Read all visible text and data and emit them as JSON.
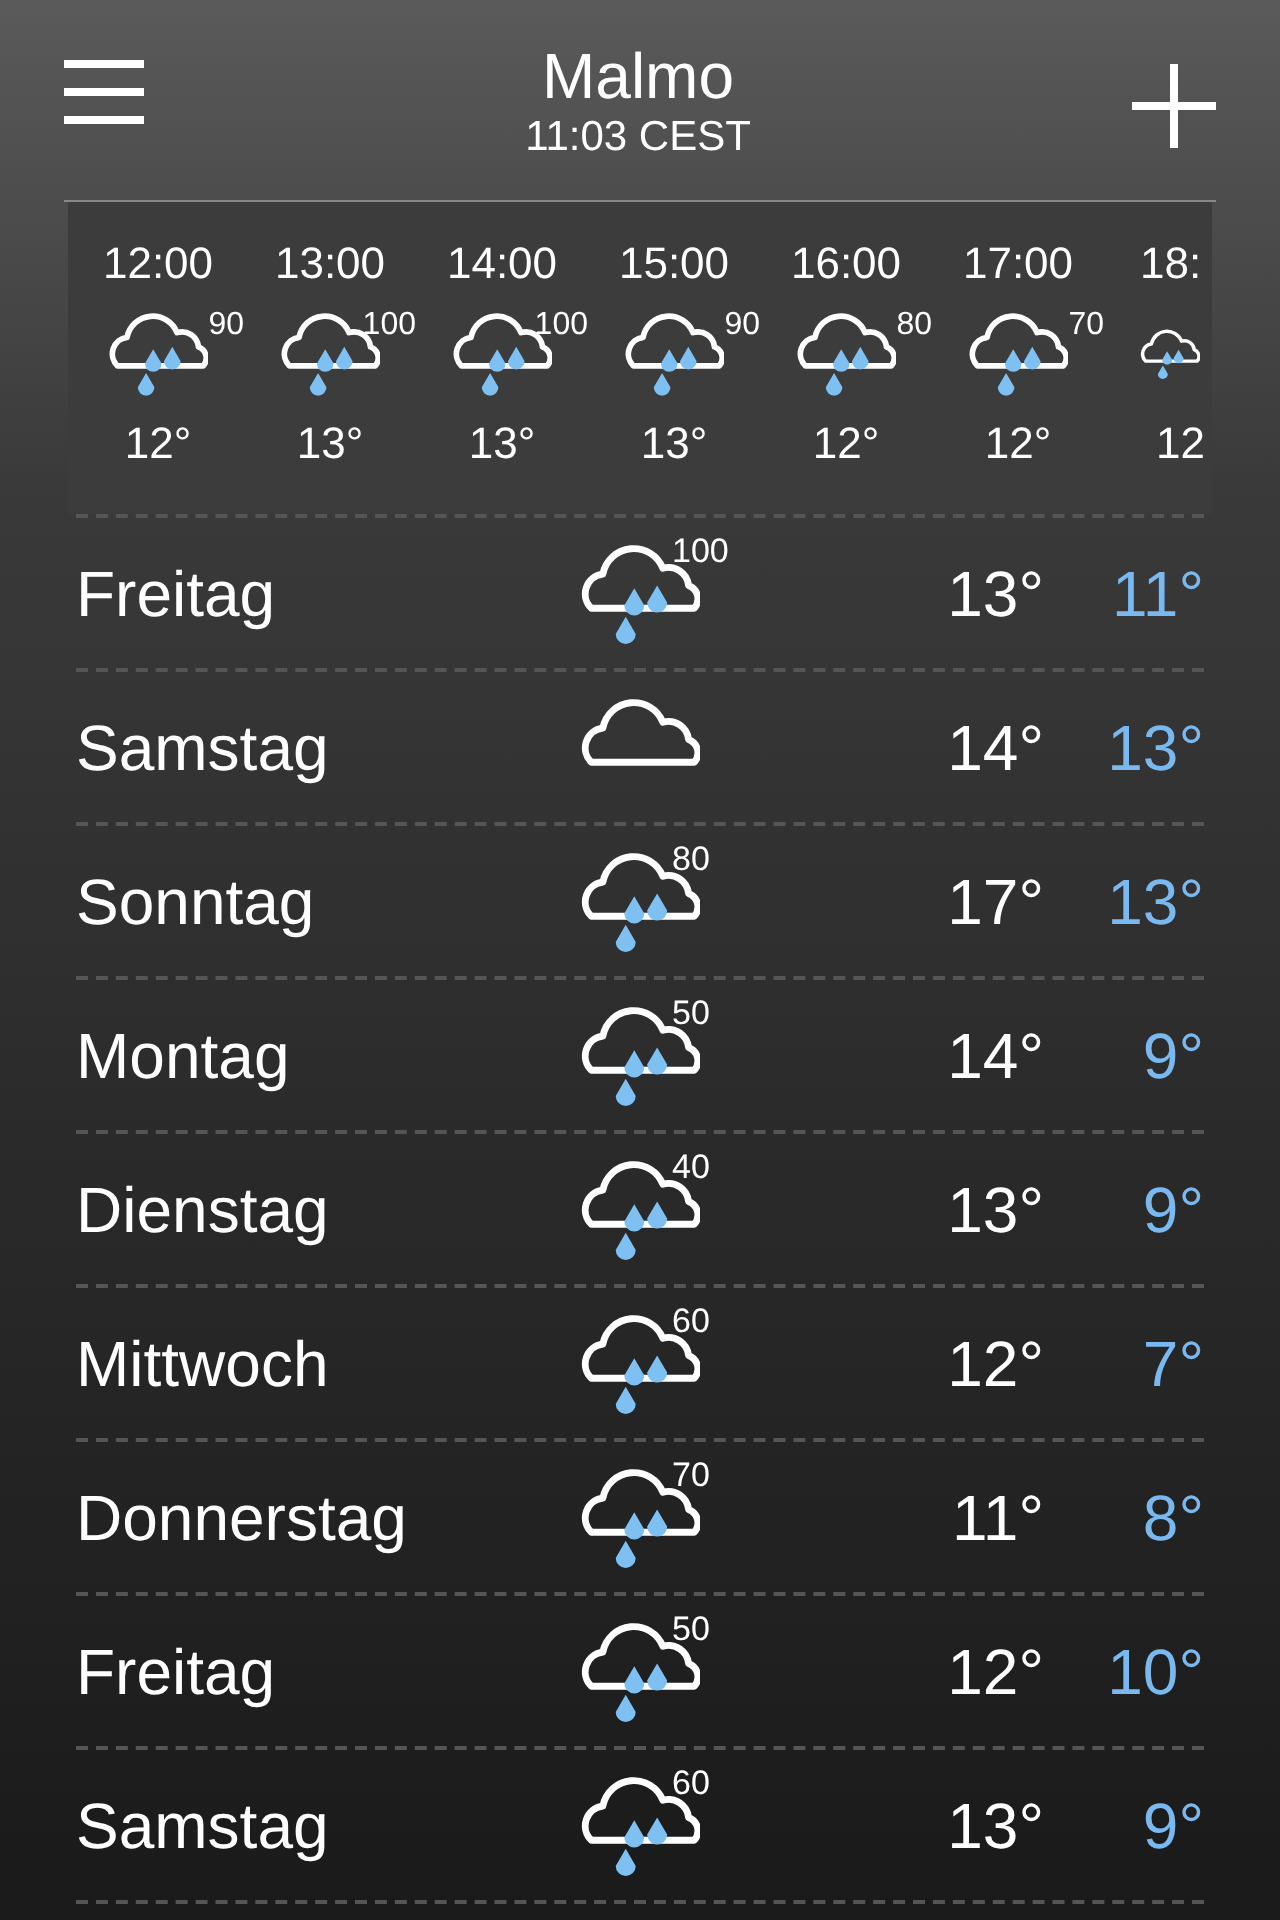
{
  "header": {
    "city": "Malmo",
    "time": "11:03 CEST"
  },
  "hourly": [
    {
      "time": "12:00",
      "kind": "rain",
      "chance": "90",
      "temp": "12°"
    },
    {
      "time": "13:00",
      "kind": "rain",
      "chance": "100",
      "temp": "13°"
    },
    {
      "time": "14:00",
      "kind": "rain",
      "chance": "100",
      "temp": "13°"
    },
    {
      "time": "15:00",
      "kind": "rain",
      "chance": "90",
      "temp": "13°"
    },
    {
      "time": "16:00",
      "kind": "rain",
      "chance": "80",
      "temp": "12°"
    },
    {
      "time": "17:00",
      "kind": "rain",
      "chance": "70",
      "temp": "12°"
    },
    {
      "time": "18:",
      "kind": "rain",
      "temp": "12"
    }
  ],
  "daily": [
    {
      "day": "Freitag",
      "kind": "rain",
      "chance": "100",
      "high": "13°",
      "low": "11°"
    },
    {
      "day": "Samstag",
      "kind": "cloud",
      "high": "14°",
      "low": "13°"
    },
    {
      "day": "Sonntag",
      "kind": "rain",
      "chance": "80",
      "high": "17°",
      "low": "13°"
    },
    {
      "day": "Montag",
      "kind": "rain",
      "chance": "50",
      "high": "14°",
      "low": "9°"
    },
    {
      "day": "Dienstag",
      "kind": "rain",
      "chance": "40",
      "high": "13°",
      "low": "9°"
    },
    {
      "day": "Mittwoch",
      "kind": "rain",
      "chance": "60",
      "high": "12°",
      "low": "7°"
    },
    {
      "day": "Donnerstag",
      "kind": "rain",
      "chance": "70",
      "high": "11°",
      "low": "8°"
    },
    {
      "day": "Freitag",
      "kind": "rain",
      "chance": "50",
      "high": "12°",
      "low": "10°"
    },
    {
      "day": "Samstag",
      "kind": "rain",
      "chance": "60",
      "high": "13°",
      "low": "9°"
    }
  ]
}
